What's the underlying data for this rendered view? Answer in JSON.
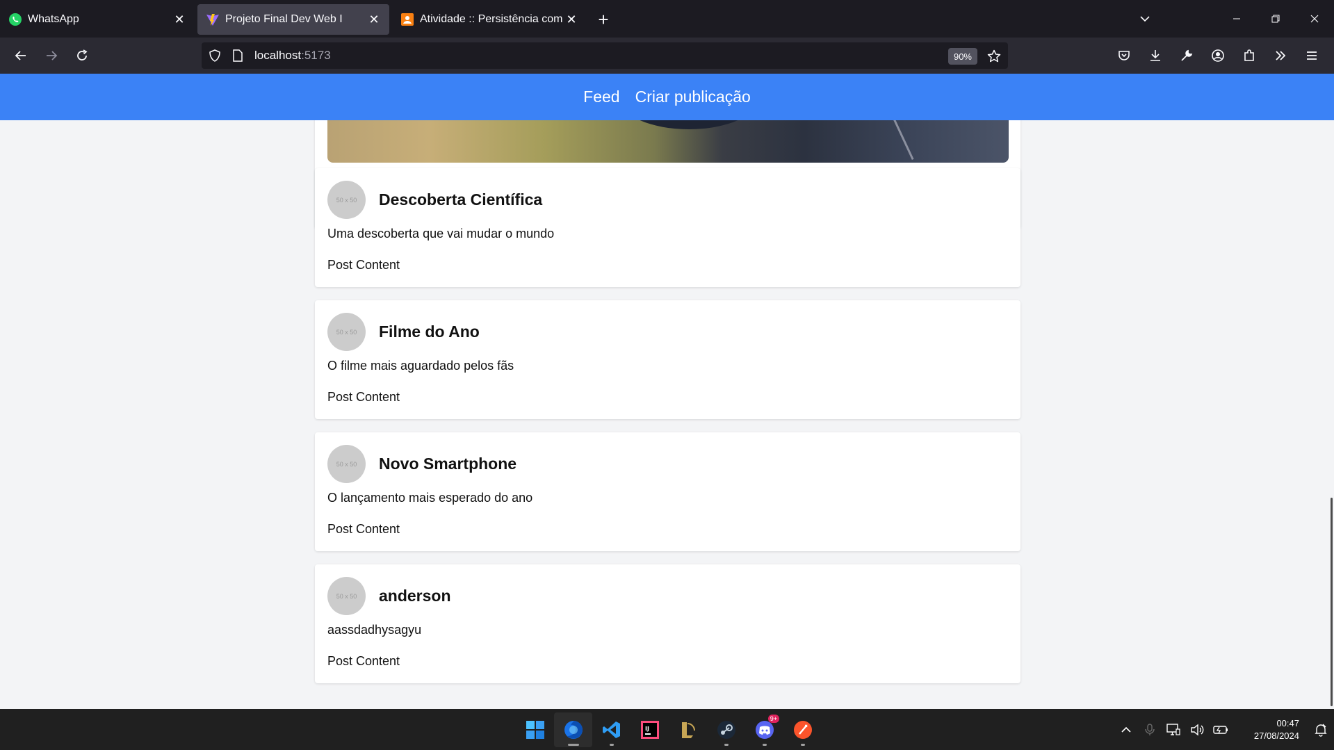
{
  "browser": {
    "tabs": [
      {
        "title": "WhatsApp",
        "icon": "whatsapp-icon",
        "active": false
      },
      {
        "title": "Projeto Final Dev Web I",
        "icon": "vite-icon",
        "active": true
      },
      {
        "title": "Atividade :: Persistência com DB",
        "icon": "moodle-icon",
        "active": false
      }
    ],
    "url": {
      "host": "localhost",
      "port": ":5173"
    },
    "zoom": "90%"
  },
  "site": {
    "nav": [
      {
        "label": "Feed"
      },
      {
        "label": "Criar publicação"
      }
    ]
  },
  "posts": [
    {
      "avatar": "50 x 50",
      "title": "Descoberta Científica",
      "description": "Uma descoberta que vai mudar o mundo",
      "content": "Post Content"
    },
    {
      "avatar": "50 x 50",
      "title": "Filme do Ano",
      "description": "O filme mais aguardado pelos fãs",
      "content": "Post Content"
    },
    {
      "avatar": "50 x 50",
      "title": "Novo Smartphone",
      "description": "O lançamento mais esperado do ano",
      "content": "Post Content"
    },
    {
      "avatar": "50 x 50",
      "title": "anderson",
      "description": "aassdadhysagyu",
      "content": "Post Content"
    }
  ],
  "taskbar": {
    "apps": [
      "windows-start-icon",
      "firefox-icon",
      "vscode-icon",
      "intellij-icon",
      "league-of-legends-icon",
      "steam-icon",
      "discord-icon",
      "brave-icon"
    ],
    "discord_badge": "9+",
    "clock": {
      "time": "00:47",
      "date": "27/08/2024"
    }
  },
  "colors": {
    "header": "#3b82f6",
    "page_bg": "#f3f4f6",
    "card_bg": "#ffffff"
  }
}
